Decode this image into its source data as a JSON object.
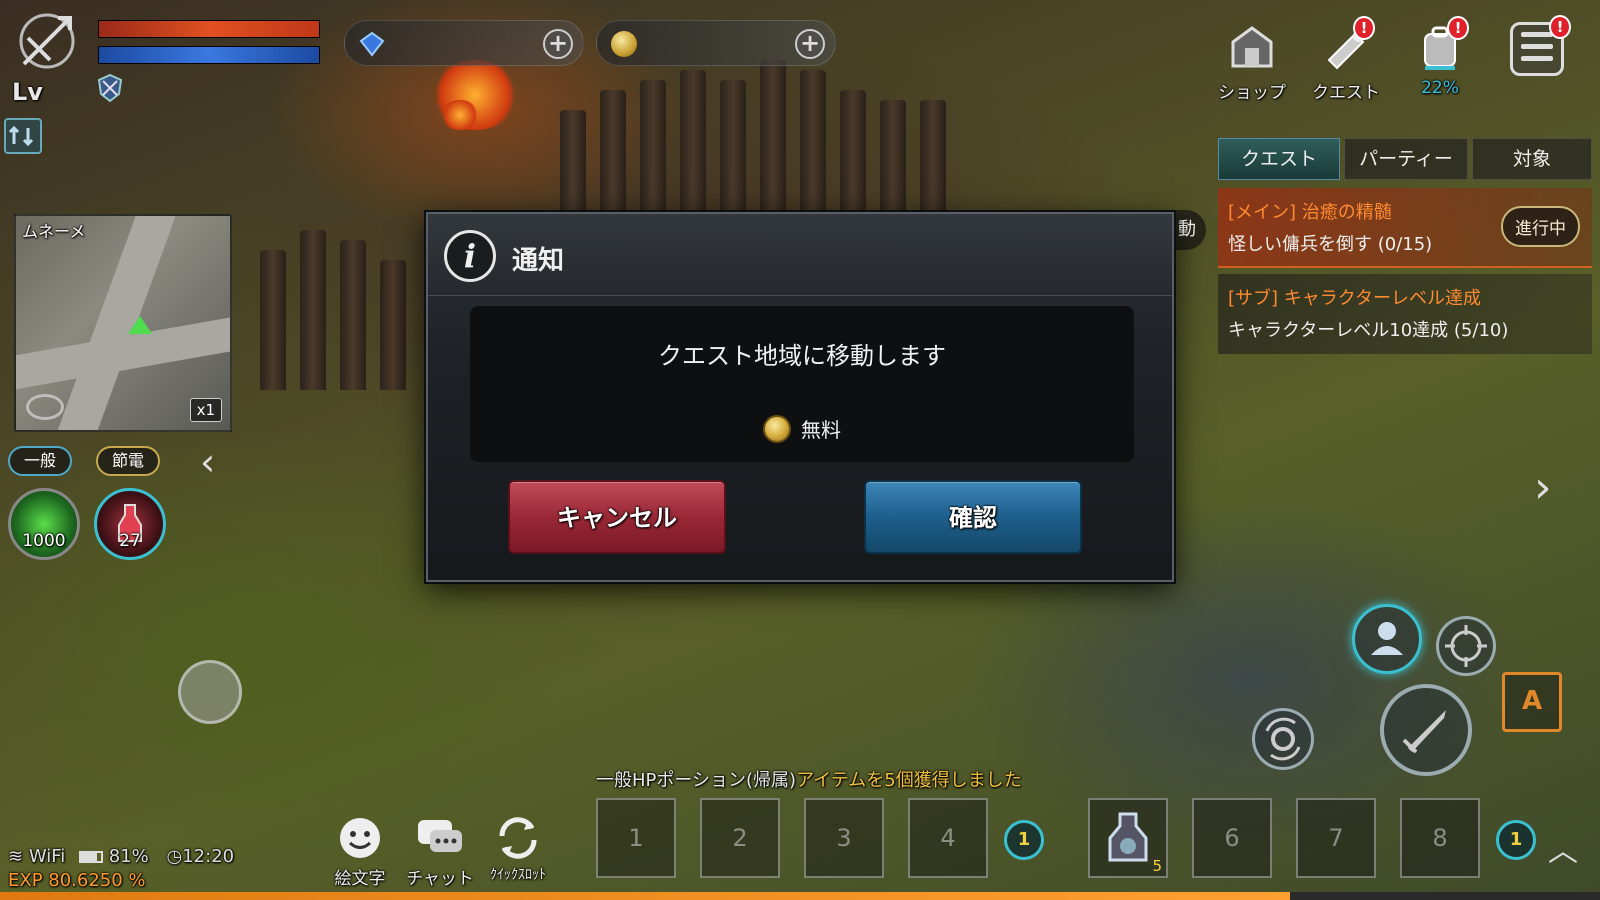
{
  "hud": {
    "level_label": "Lv",
    "shop_label": "ショップ",
    "quest_label": "クエスト",
    "bag_percent": "22%",
    "alert_mark": "!"
  },
  "quest_panel": {
    "tabs": [
      "クエスト",
      "パーティー",
      "対象"
    ],
    "active_tab": 0,
    "quests": [
      {
        "title": "[メイン] 治癒の精髄",
        "desc": "怪しい傭兵を倒す (0/15)",
        "status": "進行中"
      },
      {
        "title": "[サブ] キャラクターレベル達成",
        "desc": "キャラクターレベル10達成 (5/10)"
      }
    ],
    "hidden_text": "動"
  },
  "minimap": {
    "zone": "ムネーメ",
    "camera": "x1"
  },
  "mode_pills": {
    "general": "一般",
    "power_save": "節電"
  },
  "potions": [
    {
      "name": "green-orb",
      "count": "1000"
    },
    {
      "name": "red-potion",
      "count": "27"
    }
  ],
  "dialog": {
    "title": "通知",
    "info_glyph": "i",
    "message": "クエスト地域に移動します",
    "cost_label": "無料",
    "cancel_label": "キャンセル",
    "confirm_label": "確認"
  },
  "auto_button": "A",
  "system_message": {
    "item": "一般HPポーション(帰属)",
    "text": "アイテムを5個獲得しました"
  },
  "quickslots": {
    "left": [
      "1",
      "2",
      "3",
      "4"
    ],
    "right": [
      "6",
      "7",
      "8"
    ],
    "slot5_count": "5",
    "page_left": "1",
    "page_right": "1"
  },
  "bottom_buttons": {
    "emoji": "絵文字",
    "chat": "チャット",
    "quickslot": "ｸｲｯｸｽﾛｯﾄ"
  },
  "status_bar": {
    "wifi": "WiFi",
    "battery": "81%",
    "time": "12:20",
    "exp": "EXP 80.6250 %"
  },
  "exp_progress": 0.806,
  "colors": {
    "hp": "#e05020",
    "mp": "#3a78e0",
    "cancel": "#9a2836",
    "confirm": "#1e5f8c",
    "quest_main": "#ff8a30",
    "exp": "#ff9a30"
  }
}
